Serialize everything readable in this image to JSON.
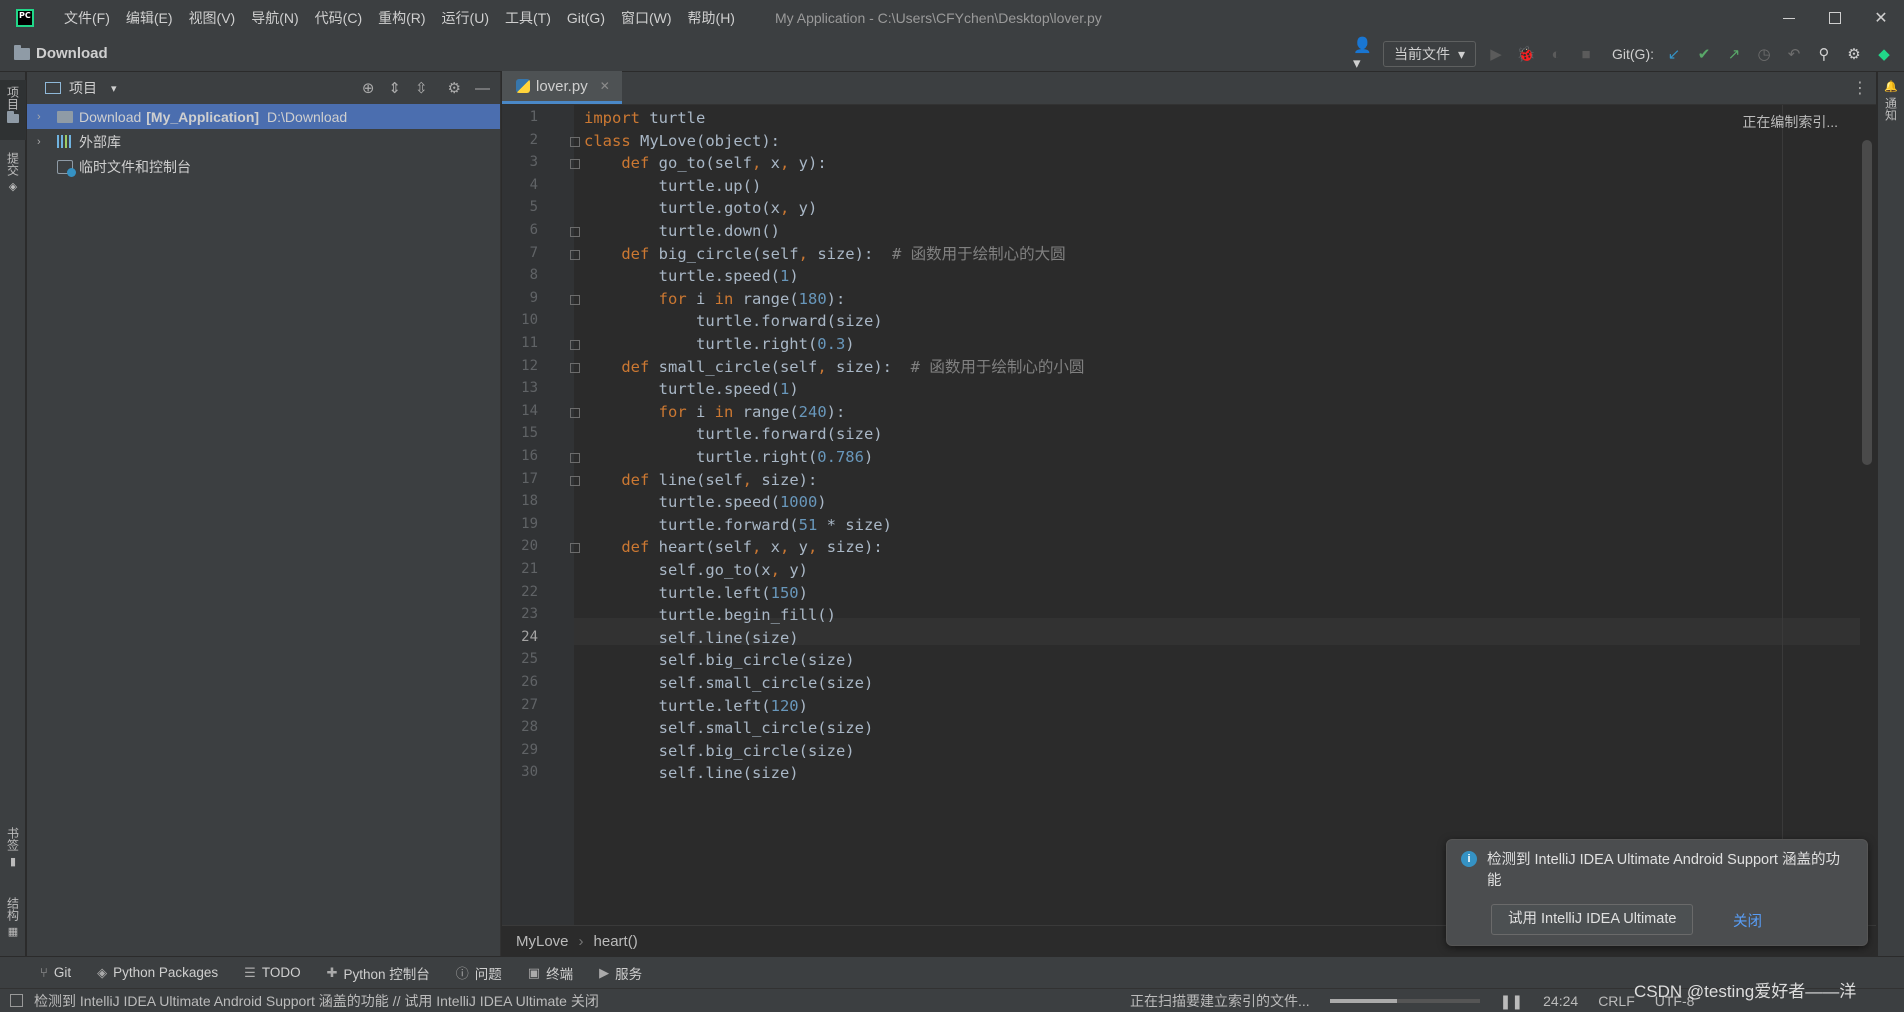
{
  "titlebar": {
    "menu": [
      "文件(F)",
      "编辑(E)",
      "视图(V)",
      "导航(N)",
      "代码(C)",
      "重构(R)",
      "运行(U)",
      "工具(T)",
      "Git(G)",
      "窗口(W)",
      "帮助(H)"
    ],
    "window_title": "My Application - C:\\Users\\CFYchen\\Desktop\\lover.py"
  },
  "navbar": {
    "folder_label": "Download",
    "run_config": "当前文件",
    "git_label": "Git(G):"
  },
  "left_stripe": {
    "project": "项目",
    "commit": "提交",
    "bookmarks": "书签",
    "structure": "结构"
  },
  "project_panel": {
    "header": "项目",
    "tree": [
      {
        "name": "Download",
        "module": "[My_Application]",
        "path": "D:\\Download"
      },
      {
        "name": "外部库"
      },
      {
        "name": "临时文件和控制台"
      }
    ]
  },
  "editor": {
    "tab_label": "lover.py",
    "indexing_hint": "正在编制索引...",
    "current_line": 24,
    "line_numbers": [
      "1",
      "2",
      "3",
      "4",
      "5",
      "6",
      "7",
      "8",
      "9",
      "10",
      "11",
      "12",
      "13",
      "14",
      "15",
      "16",
      "17",
      "18",
      "19",
      "20",
      "21",
      "22",
      "23",
      "24",
      "25",
      "26",
      "27",
      "28",
      "29",
      "30"
    ],
    "breadcrumbs": [
      "MyLove",
      "heart()"
    ]
  },
  "right_stripe": {
    "notifications": "通知"
  },
  "notification": {
    "message": "检测到 IntelliJ IDEA Ultimate Android Support 涵盖的功能",
    "button": "试用 IntelliJ IDEA Ultimate",
    "link": "关闭"
  },
  "toolwindows": [
    "Git",
    "Python Packages",
    "TODO",
    "Python 控制台",
    "问题",
    "终端",
    "服务"
  ],
  "statusbar": {
    "message": "检测到 IntelliJ IDEA Ultimate Android Support 涵盖的功能 // 试用 IntelliJ IDEA Ultimate   关闭",
    "progress_text": "正在扫描要建立索引的文件...",
    "progress": 0.45,
    "caret": "24:24",
    "line_sep": "CRLF",
    "encoding": "UTF-8"
  },
  "watermark": "CSDN @testing爱好者——洋",
  "colors": {
    "keyword": "#cc7832",
    "number": "#6897bb",
    "comment": "#808080",
    "selection": "#4b6eaf",
    "accent": "#4a88c7"
  }
}
